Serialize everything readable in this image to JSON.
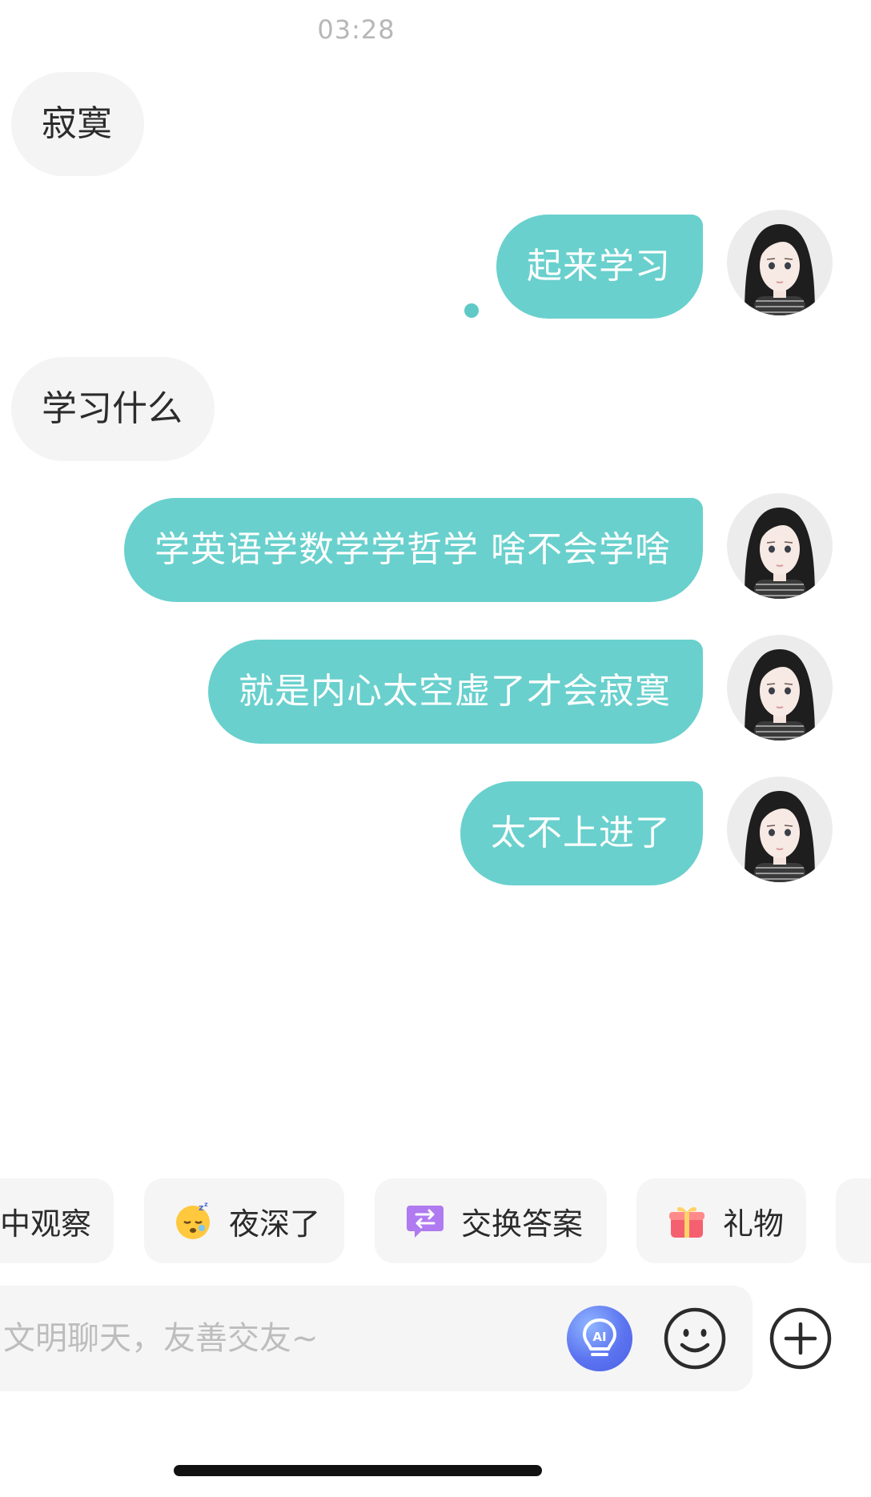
{
  "timestamp": "03:28",
  "messages": [
    {
      "side": "incoming",
      "text": "寂寞"
    },
    {
      "side": "outgoing",
      "text": "起来学习"
    },
    {
      "side": "incoming",
      "text": "学习什么"
    },
    {
      "side": "outgoing",
      "text": "学英语学数学学哲学 啥不会学啥"
    },
    {
      "side": "outgoing",
      "text": "就是内心太空虚了才会寂寞"
    },
    {
      "side": "outgoing",
      "text": "太不上进了"
    }
  ],
  "quick_actions": [
    {
      "label": "中观察",
      "icon": ""
    },
    {
      "label": "夜深了",
      "icon": "sleepy-emoji-icon"
    },
    {
      "label": "交换答案",
      "icon": "exchange-answer-icon"
    },
    {
      "label": "礼物",
      "icon": "gift-icon"
    }
  ],
  "input": {
    "placeholder": "文明聊天，友善交友~"
  },
  "toolbar_icons": [
    "ai-lightbulb-icon",
    "smiley-icon",
    "plus-circle-icon"
  ],
  "colors": {
    "outgoing_bubble": "#69d0cd",
    "incoming_bubble": "#f4f4f4",
    "ai_button": "#5c74f0"
  }
}
